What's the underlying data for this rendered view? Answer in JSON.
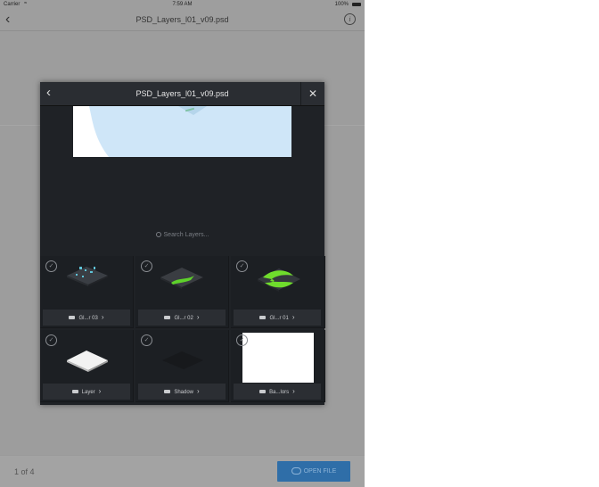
{
  "status_bar": {
    "carrier": "Carrier",
    "wifi": "≈",
    "time": "7:59 AM",
    "battery": "100%"
  },
  "nav": {
    "back": "‹",
    "title": "PSD_Layers_l01_v09.psd",
    "info": "i"
  },
  "modal": {
    "back": "‹",
    "title": "PSD_Layers_l01_v09.psd",
    "close": "✕",
    "search_placeholder": "Search Layers...",
    "layers": [
      {
        "label": "Gl...r 03",
        "chevron": "›",
        "check": "✓"
      },
      {
        "label": "Gl...r 02",
        "chevron": "›",
        "check": "✓"
      },
      {
        "label": "Gl...r 01",
        "chevron": "›",
        "check": "✓"
      },
      {
        "label": "Layer",
        "chevron": "›",
        "check": "✓"
      },
      {
        "label": "Shadow",
        "chevron": "›",
        "check": "✓"
      },
      {
        "label": "Ba...lors",
        "chevron": "›",
        "check": "✓"
      }
    ]
  },
  "footer": {
    "pager": "1 of 4",
    "open_button": "OPEN FILE"
  },
  "colors": {
    "accent": "#2f6ea8",
    "modal_bg": "#1f2226",
    "preview_bg": "#cfe6f8"
  }
}
